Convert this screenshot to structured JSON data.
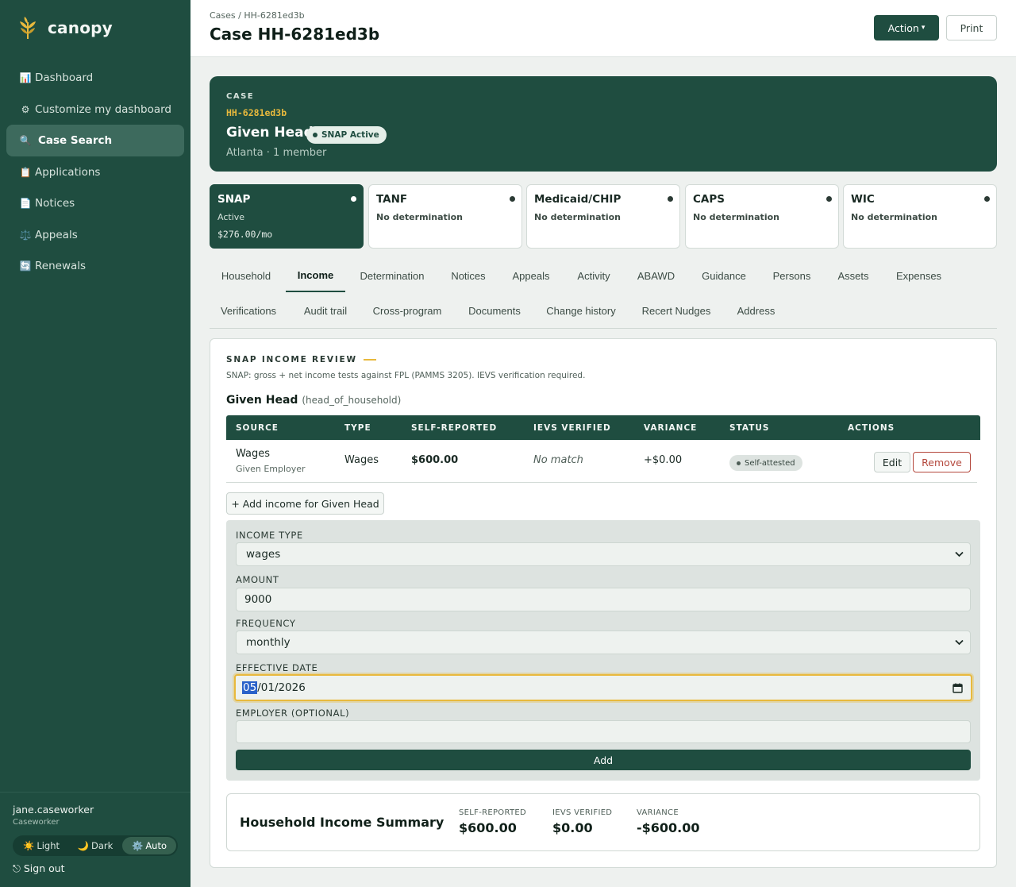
{
  "app": {
    "name": "canopy"
  },
  "sidebar": {
    "items": [
      {
        "icon": "📊",
        "label": "Dashboard"
      },
      {
        "icon": "⚙",
        "label": "Customize my dashboard"
      },
      {
        "icon": "🔍",
        "label": "Case Search"
      },
      {
        "icon": "📋",
        "label": "Applications"
      },
      {
        "icon": "📄",
        "label": "Notices"
      },
      {
        "icon": "⚖️",
        "label": "Appeals"
      },
      {
        "icon": "🔄",
        "label": "Renewals"
      }
    ],
    "active_item": "Case Search",
    "user": {
      "name": "jane.caseworker",
      "role": "Caseworker"
    },
    "theme": {
      "options": [
        {
          "icon": "☀️",
          "label": "Light"
        },
        {
          "icon": "🌙",
          "label": "Dark"
        },
        {
          "icon": "⚙️",
          "label": "Auto"
        }
      ],
      "selected": "Auto"
    },
    "signout": "⎋ Sign out"
  },
  "header": {
    "breadcrumb": "Cases / HH-6281ed3b",
    "title": "Case HH-6281ed3b",
    "action_label": "Action",
    "action_caret": "▾",
    "print_label": "Print"
  },
  "case": {
    "eyebrow": "CASE",
    "id": "HH-6281ed3b",
    "name": "Given Head",
    "badge": "SNAP Active",
    "meta": "Atlanta · 1 member"
  },
  "programs": [
    {
      "name": "SNAP",
      "status": "Active",
      "amount": "$276.00/mo",
      "active": true
    },
    {
      "name": "TANF",
      "status": "No determination",
      "amount": ""
    },
    {
      "name": "Medicaid/CHIP",
      "status": "No determination",
      "amount": ""
    },
    {
      "name": "CAPS",
      "status": "No determination",
      "amount": ""
    },
    {
      "name": "WIC",
      "status": "No determination",
      "amount": ""
    }
  ],
  "tabs": {
    "row1": [
      "Household",
      "Income",
      "Determination",
      "Notices",
      "Appeals",
      "Activity",
      "ABAWD",
      "Guidance",
      "Persons",
      "Assets",
      "Expenses"
    ],
    "row2": [
      "Verifications",
      "Audit trail",
      "Cross-program",
      "Documents",
      "Change history",
      "Recert Nudges",
      "Address"
    ],
    "active": "Income"
  },
  "income": {
    "section_title": "SNAP INCOME REVIEW",
    "section_sub": "SNAP: gross + net income tests against FPL (PAMMS 3205). IEVS verification required.",
    "person_name": "Given Head",
    "person_role": "(head_of_household)",
    "columns": [
      "SOURCE",
      "TYPE",
      "SELF-REPORTED",
      "IEVS VERIFIED",
      "VARIANCE",
      "STATUS",
      "ACTIONS"
    ],
    "rows": [
      {
        "source": "Wages",
        "employer": "Given Employer",
        "type": "Wages",
        "self_reported": "$600.00",
        "ievs": "No match",
        "variance": "+$0.00",
        "status": "Self-attested",
        "edit": "Edit",
        "remove": "Remove"
      }
    ],
    "add_button": "+ Add income for Given Head",
    "form": {
      "income_type_label": "INCOME TYPE",
      "income_type_value": "wages",
      "amount_label": "AMOUNT",
      "amount_value": "9000",
      "frequency_label": "FREQUENCY",
      "frequency_value": "monthly",
      "effective_date_label": "EFFECTIVE DATE",
      "effective_date_month": "05",
      "effective_date_rest": "/01/2026",
      "employer_label": "EMPLOYER (OPTIONAL)",
      "employer_value": "",
      "submit_label": "Add"
    },
    "summary": {
      "title": "Household Income Summary",
      "self_reported_label": "SELF-REPORTED",
      "self_reported_value": "$600.00",
      "ievs_label": "IEVS VERIFIED",
      "ievs_value": "$0.00",
      "variance_label": "VARIANCE",
      "variance_value": "-$600.00"
    }
  },
  "colors": {
    "brand": "#1f4d40",
    "accent": "#e8b93d",
    "danger": "#b4483d"
  }
}
